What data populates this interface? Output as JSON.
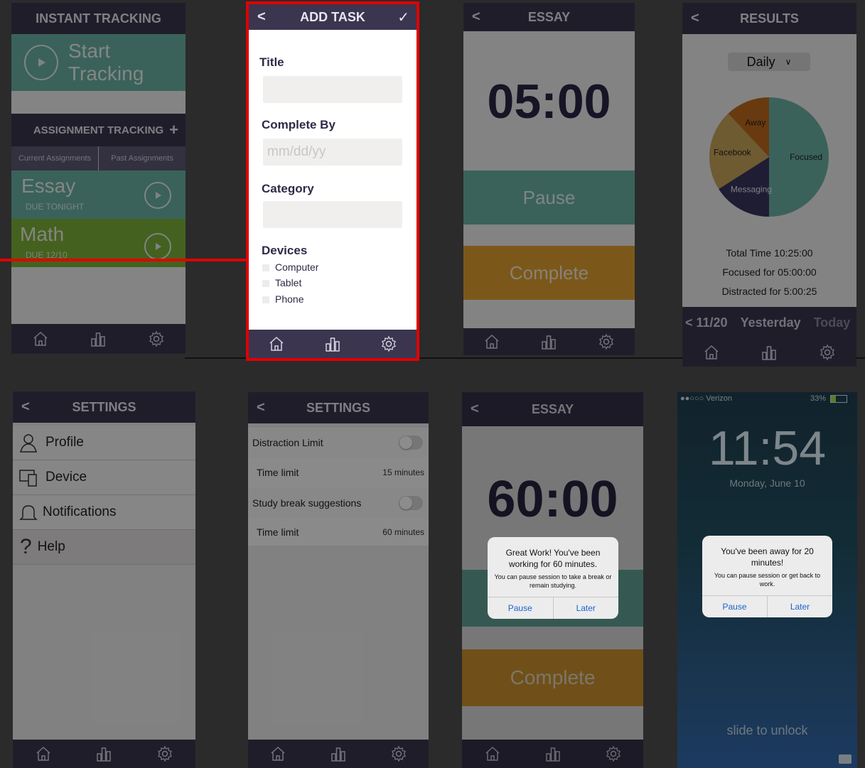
{
  "s1": {
    "title": "INSTANT TRACKING",
    "start_label": "Start Tracking",
    "assign_title": "ASSIGNMENT TRACKING",
    "add_symbol": "+",
    "tabs": [
      "Current Assignments",
      "Past Assignments"
    ],
    "assignments": [
      {
        "name": "Essay",
        "due": "DUE TONIGHT"
      },
      {
        "name": "Math",
        "due": "DUE 12/10"
      }
    ]
  },
  "s2": {
    "back": "<",
    "title": "ADD TASK",
    "check": "✓",
    "title_label": "Title",
    "complete_label": "Complete By",
    "complete_placeholder": "mm/dd/yy",
    "category_label": "Category",
    "devices_label": "Devices",
    "devices": [
      "Computer",
      "Tablet",
      "Phone"
    ]
  },
  "s3": {
    "back": "<",
    "title": "ESSAY",
    "timer": "05:00",
    "pause": "Pause",
    "complete": "Complete"
  },
  "s4": {
    "back": "<",
    "title": "RESULTS",
    "dropdown": "Daily",
    "chart_data": {
      "type": "pie",
      "categories": [
        "Focused",
        "Messaging",
        "Facebook",
        "Away"
      ],
      "values": [
        50,
        16,
        22,
        12
      ],
      "colors": [
        "#6bb3a4",
        "#3a3560",
        "#c9a75a",
        "#c06a1c"
      ]
    },
    "total": "Total Time 10:25:00",
    "focused": "Focused for 05:00:00",
    "distracted": "Distracted for 5:00:25",
    "nav_prev": "< 11/20",
    "nav_yesterday": "Yesterday",
    "nav_today": "Today"
  },
  "s5": {
    "back": "<",
    "title": "SETTINGS",
    "items": [
      "Profile",
      "Device",
      "Notifications",
      "Help"
    ]
  },
  "s6": {
    "back": "<",
    "title": "SETTINGS",
    "rows": [
      {
        "label": "Distraction Limit"
      },
      {
        "label": "Time limit",
        "value": "15 minutes"
      },
      {
        "label": "Study break suggestions"
      },
      {
        "label": "Time limit",
        "value": "60 minutes"
      }
    ]
  },
  "s7": {
    "back": "<",
    "title": "ESSAY",
    "timer": "60:00",
    "complete": "Complete",
    "alert_title": "Great Work! You've been working for 60 minutes.",
    "alert_sub": "You can pause session to take a break or remain studying.",
    "btn_pause": "Pause",
    "btn_later": "Later"
  },
  "s8": {
    "carrier": "●●○○○ Verizon",
    "battery": "33%",
    "time": "11:54",
    "date": "Monday, June 10",
    "alert_title": "You've been away for 20 minutes!",
    "alert_sub": "You can pause session or get back to work.",
    "btn_pause": "Pause",
    "btn_later": "Later",
    "unlock": "slide to unlock"
  },
  "colors": {
    "purple": "#3b354f",
    "teal": "#6bb3a4",
    "gold": "#e0a030",
    "green": "#7fb13a",
    "highlight": "#e00000"
  }
}
